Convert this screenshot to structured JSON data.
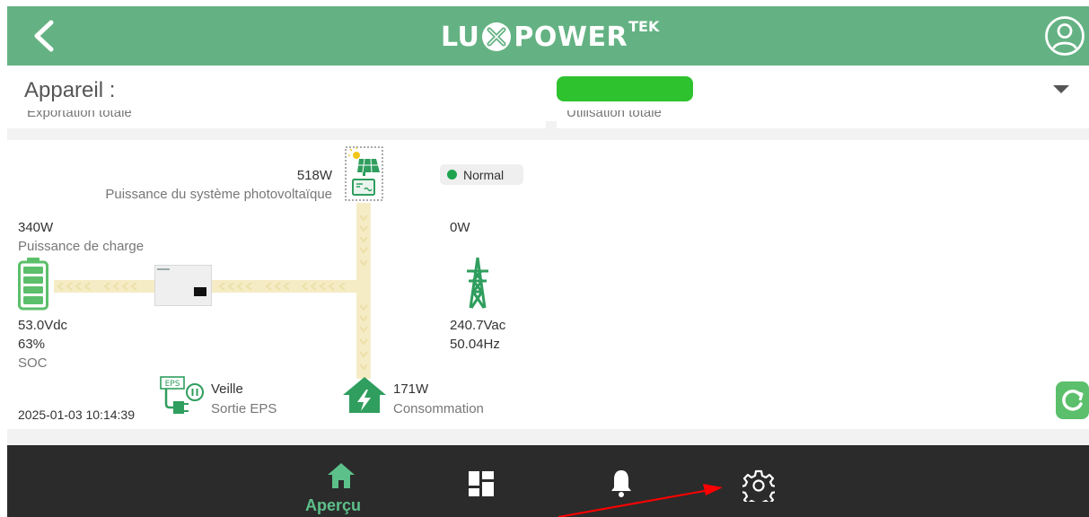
{
  "header": {
    "logo_left": "LU",
    "logo_right": "POWER",
    "logo_sup": "TEK",
    "brand_color": "#64b283"
  },
  "device": {
    "label": "Appareil :",
    "selected_value": "",
    "selected_color": "#2fc22f",
    "ghost_left": "Exportation totale",
    "ghost_right": "Utilisation totale"
  },
  "flow": {
    "pv_power": "518W",
    "pv_label": "Puissance du système photovoltaïque",
    "status": "Normal",
    "status_color": "#1fa44e",
    "battery_power": "340W",
    "battery_label": "Puissance de charge",
    "battery_voltage": "53.0Vdc",
    "battery_soc": "63%",
    "soc_label": "SOC",
    "grid_power": "0W",
    "grid_voltage": "240.7Vac",
    "grid_frequency": "50.04Hz",
    "eps_icon_text": "EPS",
    "eps_state": "Veille",
    "eps_label": "Sortie EPS",
    "consumption_power": "171W",
    "consumption_label": "Consommation",
    "timestamp": "2025-01-03 10:14:39"
  },
  "nav": {
    "items": [
      {
        "icon": "home-icon",
        "label": "Aperçu",
        "active": true
      },
      {
        "icon": "dashboard-icon",
        "label": "",
        "active": false
      },
      {
        "icon": "bell-icon",
        "label": "",
        "active": false
      },
      {
        "icon": "gear-icon",
        "label": "",
        "active": false
      }
    ],
    "active_color": "#5cc08a"
  },
  "annotation_color": "#ff0000"
}
